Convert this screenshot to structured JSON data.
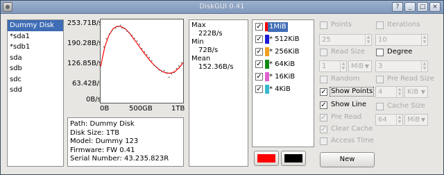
{
  "window": {
    "title": "DiskGUI 0.41",
    "buttons": [
      "?",
      "_",
      "□",
      "×"
    ]
  },
  "devices": {
    "items": [
      "Dummy Disk",
      "*sda1",
      "*sdb1",
      "sda",
      "sdb",
      "sdc",
      "sdd"
    ],
    "selected_index": 0
  },
  "chart_data": {
    "type": "scatter",
    "x_tick_labels": [
      "0B",
      "500GB",
      "1TB"
    ],
    "y_tick_labels": [
      "253.71B/s",
      "190.28B/s",
      "126.85B/s",
      "63.42B/s",
      "0B/s"
    ],
    "xlim": [
      0,
      1000
    ],
    "ylim": [
      0,
      253.71
    ],
    "x_unit": "GB",
    "y_unit": "B/s",
    "grid": false,
    "series": [
      {
        "line": true,
        "color": "#ff0000",
        "x": [
          0,
          50,
          100,
          150,
          200,
          250,
          300,
          350,
          400,
          450,
          500,
          550,
          600,
          650,
          700,
          750,
          800,
          850,
          900,
          950,
          1000
        ],
        "values": [
          110,
          170,
          205,
          225,
          233,
          232,
          225,
          212,
          195,
          178,
          160,
          144,
          128,
          114,
          103,
          95,
          90,
          90,
          95,
          106,
          122
        ]
      },
      {
        "line": false,
        "color": "#555555",
        "x": [
          40,
          70,
          110,
          140,
          180,
          210,
          240,
          260,
          290,
          320,
          350,
          380,
          410,
          440,
          470,
          500,
          530,
          560,
          590,
          620,
          650,
          680,
          710,
          740,
          770,
          800,
          830,
          860,
          890,
          920,
          950,
          980
        ],
        "values": [
          170,
          195,
          210,
          220,
          228,
          232,
          236,
          228,
          226,
          218,
          212,
          205,
          196,
          188,
          178,
          165,
          155,
          146,
          138,
          128,
          114,
          108,
          100,
          96,
          98,
          92,
          78,
          88,
          92,
          104,
          112,
          122
        ]
      }
    ]
  },
  "info": {
    "path": "Path: Dummy Disk",
    "size": "Disk Size: 1TB",
    "model": "Model: Dummy 123",
    "firmware": "Firmware: FW  0.41",
    "serial": "Serial Number: 43.235.823R"
  },
  "stats": {
    "max_label": "Max",
    "max_value": "222B/s",
    "min_label": "Min",
    "min_value": "72B/s",
    "mean_label": "Mean",
    "mean_value": "152.36B/s"
  },
  "series_list": [
    {
      "label": "1MiB",
      "color": "#ff0000",
      "checked": true
    },
    {
      "label": "* 512KiB",
      "color": "#1b1bd6",
      "checked": true
    },
    {
      "label": "* 256KiB",
      "color": "#f0a020",
      "checked": true
    },
    {
      "label": "* 64KiB",
      "color": "#138a13",
      "checked": true
    },
    {
      "label": "* 16KiB",
      "color": "#e060d0",
      "checked": true
    },
    {
      "label": "* 4KiB",
      "color": "#38b8d0",
      "checked": true
    }
  ],
  "color_buttons": {
    "left_color": "#ff0000",
    "right_color": "#000000"
  },
  "options": {
    "points_label": "Points",
    "points_value": "25",
    "iterations_label": "Iterations",
    "iterations_value": "10",
    "read_size_label": "Read Size",
    "read_size_value": "1",
    "read_size_unit": "MiB",
    "degree_label": "Degree",
    "degree_value": "3",
    "random_label": "Random",
    "pre_read_size_label": "Pre Read Size",
    "pre_read_size_value": "4",
    "pre_read_size_unit": "KiB",
    "show_points_label": "Show Points",
    "show_line_label": "Show Line",
    "cache_size_label": "Cache Size",
    "cache_size_value": "64",
    "cache_size_unit": "MiB",
    "pre_read_label": "Pre Read",
    "clear_cache_label": "Clear Cache",
    "access_time_label": "Access Time",
    "check_mark": "✓"
  },
  "new_button_label": "New"
}
